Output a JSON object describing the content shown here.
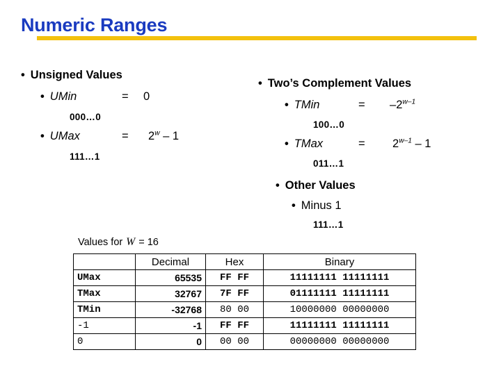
{
  "slide": {
    "title": "Numeric Ranges",
    "accent_title_color": "#1a3bc0",
    "accent_rule_color": "#f3c10d",
    "background_color": "#ffffff"
  },
  "left_column": {
    "heading": "Unsigned Values",
    "entries": [
      {
        "name": "UMin",
        "equals": "=",
        "value_base": "0",
        "value_exp": "",
        "value_tail": "",
        "bits": "000…0"
      },
      {
        "name": "UMax",
        "equals": "=",
        "value_base": "2",
        "value_exp": "w",
        "value_tail": " – 1",
        "bits": "111…1"
      }
    ]
  },
  "right_column": {
    "heading": "Two’s Complement Values",
    "entries": [
      {
        "name": "TMin",
        "equals": "=",
        "value_prefix": "–",
        "value_base": "2",
        "value_exp": "w–1",
        "value_tail": "",
        "bits": "100…0"
      },
      {
        "name": "TMax",
        "equals": "=",
        "value_prefix": "",
        "value_base": "2",
        "value_exp": "w–1",
        "value_tail": " – 1",
        "bits": "011…1"
      }
    ],
    "other": {
      "heading": "Other Values",
      "item": "Minus 1",
      "bits": "111…1"
    }
  },
  "caption": {
    "prefix": "Values for ",
    "variable": "W",
    "suffix": " = 16"
  },
  "table": {
    "headers": [
      "",
      "Decimal",
      "Hex",
      "Binary"
    ],
    "rows": [
      {
        "label": "UMax",
        "decimal": "65535",
        "hex": "FF FF",
        "binary": "11111111 11111111",
        "label_bold": true
      },
      {
        "label": "TMax",
        "decimal": "32767",
        "hex": "7F FF",
        "binary": "01111111 11111111",
        "label_bold": true
      },
      {
        "label": "TMin",
        "decimal": "-32768",
        "hex": "80 00",
        "binary": "10000000 00000000",
        "label_bold": true
      },
      {
        "label": "-1",
        "decimal": "-1",
        "hex": "FF FF",
        "binary": "11111111 11111111",
        "label_bold": false
      },
      {
        "label": "0",
        "decimal": "0",
        "hex": "00 00",
        "binary": "00000000 00000000",
        "label_bold": false
      }
    ]
  }
}
